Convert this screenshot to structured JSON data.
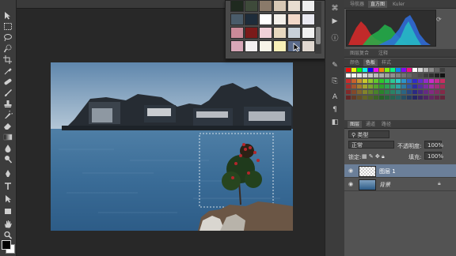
{
  "panels": {
    "nav_tabs": [
      "导航器",
      "直方图",
      "Kuler"
    ],
    "color_tabs": [
      "颜色",
      "色板",
      "样式"
    ],
    "sample_tabs": [
      "图层复合",
      "注释"
    ],
    "layer_tabs": [
      "图层",
      "通道",
      "路径"
    ]
  },
  "layers_panel": {
    "kind_filter": "类型",
    "blend_mode": "正常",
    "opacity_label": "不透明度:",
    "opacity_value": "100%",
    "lock_label": "锁定:",
    "fill_label": "填充:",
    "fill_value": "100%",
    "layers": [
      {
        "name": "图层 1",
        "selected": true
      },
      {
        "name": "背景",
        "selected": false
      }
    ]
  },
  "colors": {
    "foreground": "#000000",
    "background": "#ffffff",
    "accent": "#3d8fd1"
  },
  "popup_swatches": [
    [
      "#1f2a1f",
      "#3e4a3a",
      "#8a7a6a",
      "#d8c9b6",
      "#e8ddd0",
      "#efefef"
    ],
    [
      "#4a5c6a",
      "#1e2c3a",
      "#ffffff",
      "#f4f0ea",
      "#f2d8c8",
      "#e8e8f0"
    ],
    [
      "#c98a98",
      "#7a1a1a",
      "#f0d0d8",
      "#e8d8c0",
      "#c8d0d8",
      "#f0f0f0"
    ],
    [
      "#d8a8b8",
      "#f4f0f0",
      "#f8f4e8",
      "#f8f0b8",
      "#5a6a8a",
      "#e0d8d0"
    ]
  ],
  "icons": {
    "toolbar": [
      "move-icon",
      "marquee-icon",
      "lasso-icon",
      "quick-select-icon",
      "crop-icon",
      "eyedropper-icon",
      "healing-icon",
      "brush-icon",
      "stamp-icon",
      "history-brush-icon",
      "eraser-icon",
      "gradient-icon",
      "blur-icon",
      "dodge-icon",
      "pen-icon",
      "type-icon",
      "path-select-icon",
      "shape-icon",
      "hand-icon",
      "zoom-icon"
    ]
  }
}
